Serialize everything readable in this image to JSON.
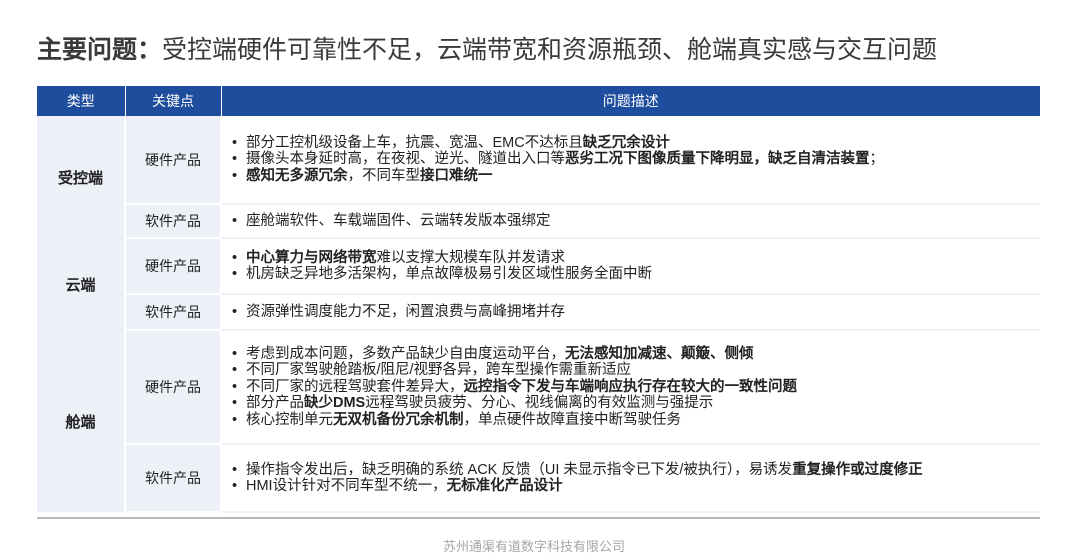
{
  "title": {
    "lead": "主要问题：",
    "rest": "受控端硬件可靠性不足，云端带宽和资源瓶颈、舱端真实感与交互问题"
  },
  "table": {
    "headers": {
      "type": "类型",
      "key": "关键点",
      "desc": "问题描述"
    },
    "categories": {
      "controlled": "受控端",
      "cloud": "云端",
      "cabin": "舱端"
    },
    "rows": {
      "controlled_hw": {
        "key": "硬件产品",
        "b1": {
          "t1": "部分工控机级设备上车，抗震、宽温、EMC不达标且",
          "b": "缺乏冗余设计"
        },
        "b2": {
          "t1": "摄像头本身延时高，在夜视、逆光、隧道出入口等",
          "b": "恶劣工况下图像质量下降明显，缺乏自清洁装置",
          "t2": "；"
        },
        "b3": {
          "b": "感知无多源冗余",
          "t1": "，不同车型",
          "b2": "接口难统一"
        }
      },
      "controlled_sw": {
        "key": "软件产品",
        "b1": {
          "t1": "座舱端软件、车载端固件、云端转发版本强绑定"
        }
      },
      "cloud_hw": {
        "key": "硬件产品",
        "b1": {
          "b": "中心算力与网络带宽",
          "t1": "难以支撑大规模车队并发请求"
        },
        "b2": {
          "t1": "机房缺乏异地多活架构，单点故障极易引发区域性服务全面中断"
        }
      },
      "cloud_sw": {
        "key": "软件产品",
        "b1": {
          "t1": "资源弹性调度能力不足，闲置浪费与高峰拥堵并存"
        }
      },
      "cabin_hw": {
        "key": "硬件产品",
        "b1": {
          "t1": "考虑到成本问题，多数产品缺少自由度运动平台，",
          "b": "无法感知加减速、颠簸、侧倾"
        },
        "b2": {
          "t1": "不同厂家驾驶舱踏板/阻尼/视野各异，跨车型操作需重新适应"
        },
        "b3": {
          "t1": "不同厂家的远程驾驶套件差异大，",
          "b": "远控指令下发与车端响应执行存在较大的一致性问题"
        },
        "b4": {
          "t1": "部分产品",
          "b": "缺少DMS",
          "t2": "远程驾驶员疲劳、分心、视线偏离的有效监测与强提示"
        },
        "b5": {
          "t1": "核心控制单元",
          "b": "无双机备份冗余机制",
          "t2": "，单点硬件故障直接中断驾驶任务"
        }
      },
      "cabin_sw": {
        "key": "软件产品",
        "b1": {
          "t1": "操作指令发出后，缺乏明确的系统 ACK 反馈（UI 未显示指令已下发/被执行），易诱发",
          "b": "重复操作或过度修正"
        },
        "b2": {
          "t1": "HMI设计针对不同车型不统一，",
          "b": "无标准化产品设计"
        }
      }
    }
  },
  "footer": "苏州通渠有道数字科技有限公司"
}
